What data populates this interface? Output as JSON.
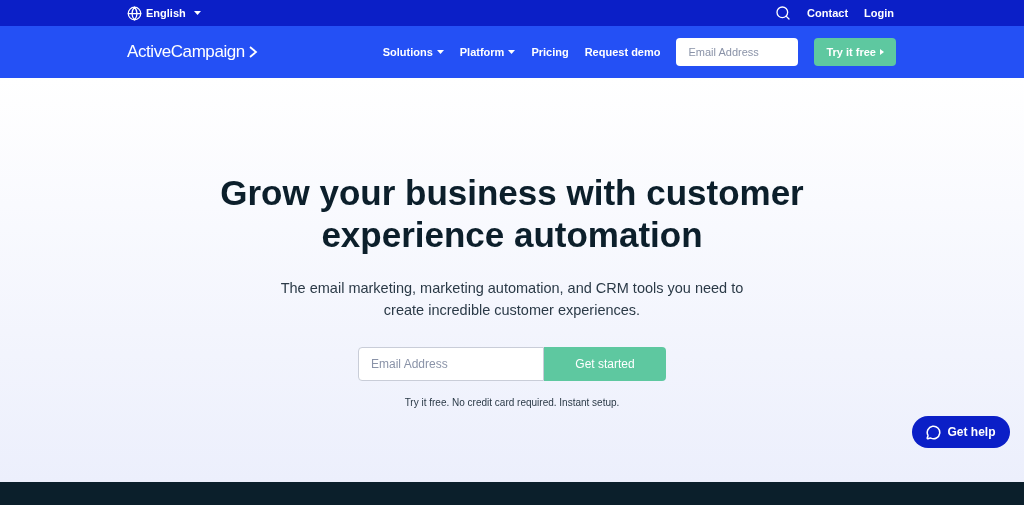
{
  "top_bar": {
    "language": "English",
    "links": [
      "Contact",
      "Login"
    ]
  },
  "nav": {
    "logo": "ActiveCampaign",
    "items": [
      {
        "label": "Solutions",
        "dropdown": true
      },
      {
        "label": "Platform",
        "dropdown": true
      },
      {
        "label": "Pricing",
        "dropdown": false
      },
      {
        "label": "Request demo",
        "dropdown": false
      }
    ],
    "email": {
      "placeholder": "Email Address"
    },
    "cta": "Try it free"
  },
  "hero": {
    "title_lines": [
      "Grow your business with customer",
      "experience automation"
    ],
    "subtitle_lines": [
      "The email marketing, marketing automation, and CRM tools you need to",
      "create incredible customer experiences."
    ],
    "email": {
      "placeholder": "Email Address"
    },
    "button": "Get started",
    "note": "Try it free. No credit card required. Instant setup."
  },
  "help_button": "Get help"
}
